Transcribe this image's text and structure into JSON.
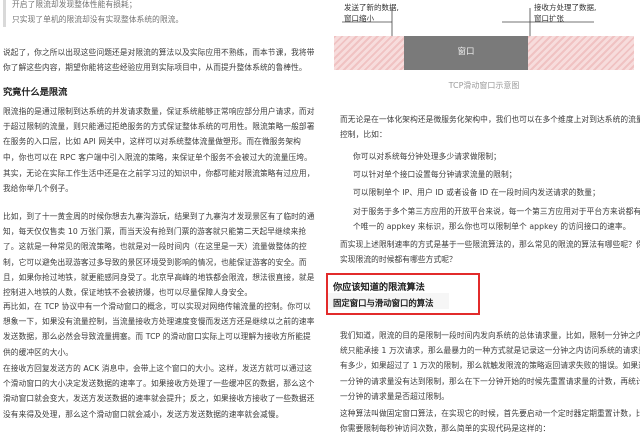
{
  "left": {
    "top_quote": [
      "开启了限流却发现整体性能有损耗；",
      "只实现了单机的限流却没有实现整体系统的限流。"
    ],
    "para1": [
      "说起了，你之所以出现这些问题还是对限流的算法以及实际应用不熟练，而本节课，我将带",
      "你了解这些内容，期望你能将这些经验应用到实际项目中，从而提升整体系统的鲁棒性。"
    ],
    "heading_why": "究竟什么是限流",
    "para2": [
      "限流指的是通过限制到达系统的并发请求数量，保证系统能够正常响应部分用户请求，而对",
      "于超过限制的流量，则只能通过拒绝服务的方式保证整体系统的可用性。限流策略一般部署",
      "在服务的入口层，比如 API 网关中，这样可以对系统整体流量做塑形。而在微服务架构",
      "中，你也可以在 RPC 客户端中引入限流的策略，来保证单个服务不会被过大的流量压垮。"
    ],
    "para3": [
      "其实，无论在实际工作生活中还是在之前学习过的知识中，你都可能对限流策略有过应用，",
      "我给你举几个例子。"
    ],
    "para4": [
      "比如，到了十一黄金周的时候你想去九寨沟游玩，结果到了九寨沟才发现景区有了临时的通",
      "知，每天仅仅售卖 10 万张门票，而当天没有抢到门票的游客就只能第二天起早继续来抢",
      "了。这就是一种常见的限流策略，也就是对一段时间内（在这里是一天）流量做整体的控",
      "制，它可以避免出现游客过多导致的景区环境受到影响的情况，也能保证游客的安全。而",
      "且，如果你抢过地铁，就更能感同身受了。北京早高峰的地铁都会限流，想法很直接，就是",
      "控制进入地铁的人数，保证地铁不会被挤爆，也可以尽量保障人身安全。"
    ],
    "para5": [
      "再比如，在 TCP 协议中有一个滑动窗口的概念，可以实现对网络传输流量的控制。你可以",
      "想象一下，如果没有流量控制，当流量接收方处理速度变慢而发送方还是继续以之前的速率",
      "发送数据，那么必然会导致流量拥塞。而 TCP 的滑动窗口实际上可以理解为接收方所能提",
      "供的缓冲区的大小。"
    ],
    "para6": [
      "在接收方回复发送方的 ACK 消息中，会带上这个窗口的大小。这样，发送方就可以通过这",
      "个滑动窗口的大小决定发送数据的速率了。如果接收方处理了一些缓冲区的数据，那么这个",
      "滑动窗口就会变大，发送方发送数据的速率就会提升；反之，如果接收方接收了一些数据还",
      "没有来得及处理，那么这个滑动窗口就会减小，发送方发送数据的速率就会减慢。"
    ]
  },
  "right": {
    "diagram": {
      "note_left": [
        "发送了新的数据,",
        "窗口缩小"
      ],
      "note_right": [
        "接收方处理了数据,",
        "窗口扩张"
      ],
      "window_label": "窗口",
      "caption": "TCP滑动窗口示意图"
    },
    "para1": [
      "而无论是在一体化架构还是微服务化架构中，我们也可以在多个维度上对到达系统的流量做",
      "控制，比如："
    ],
    "bullets": [
      "你可以对系统每分钟处理多少请求做限制；",
      "可以针对单个接口设置每分钟请求流量的限制；",
      "可以限制单个 IP、用户 ID 或者设备 ID 在一段时间内发送请求的数量；",
      "对于服务于多个第三方应用的开放平台来说，每一个第三方应用对于平台方来说都有一",
      "个唯一的 appkey 来标识，那么你也可以限制单个 appkey 的访问接口的速率。"
    ],
    "para2": [
      "而实现上述限制速率的方式是基于一些限流算法的，那么常见的限流的算法有哪些呢？你在",
      "实现限流的时候都有哪些方式呢？"
    ],
    "heading_algo": "你应该知道的限流算法",
    "heading_fixed": "固定窗口与滑动窗口的算法",
    "para3": [
      "我们知道，限流的目的是限制一段时间内发向系统的总体请求量，比如，限制一分钟之内系",
      "统只能承接 1 万次请求，那么最暴力的一种方式就是记录这一分钟之内访问系统的请求量",
      "有多少，如果超过了 1 万次的限制，那么就触发限流的策略返回请求失败的错误。如果这",
      "一分钟的请求量没有达到限制，那么在下一分钟开始的时候先重置请求量的计数，再统计这",
      "一分钟的请求量是否超过限制。"
    ],
    "para4": [
      "这种算法叫做固定窗口算法，在实现它的时候，首先要启动一个定时器定期重置计数，比如",
      "你需要限制每秒钟访问次数，那么简单的实现代码是这样的："
    ]
  }
}
